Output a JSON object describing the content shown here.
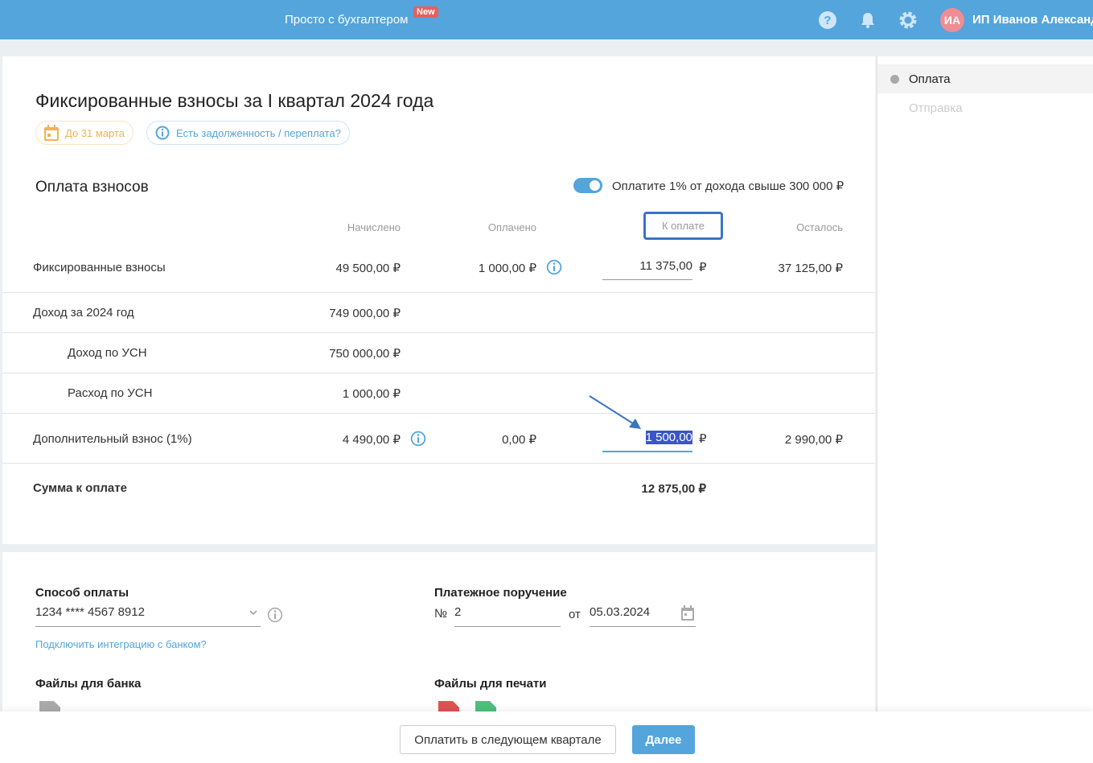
{
  "header": {
    "brand": "Просто с бухгалтером",
    "badge": "New",
    "avatar": "ИА",
    "user": "ИП Иванов Александ"
  },
  "sidebar": {
    "items": [
      {
        "label": "Оплата",
        "active": true
      },
      {
        "label": "Отправка",
        "active": false
      }
    ]
  },
  "page": {
    "title": "Фиксированные взносы за I квартал 2024 года",
    "deadline": "До 31 марта",
    "debt_link": "Есть задолженность / переплата?"
  },
  "payments": {
    "title": "Оплата взносов",
    "toggle_label": "Оплатите 1% от дохода свыше 300 000 ₽",
    "toggle_on": true,
    "columns": [
      "Начислено",
      "Оплачено",
      "К оплате",
      "Осталось"
    ],
    "currency": "₽",
    "rows": {
      "fixed": {
        "label": "Фиксированные взносы",
        "accrued": "49 500,00 ₽",
        "paid": "1 000,00 ₽",
        "to_pay": "11 375,00",
        "left": "37 125,00 ₽"
      },
      "income": {
        "label": "Доход за 2024 год",
        "accrued": "749 000,00 ₽"
      },
      "usn_income": {
        "label": "Доход по УСН",
        "accrued": "750 000,00 ₽"
      },
      "usn_expense": {
        "label": "Расход по УСН",
        "accrued": "1 000,00 ₽"
      },
      "extra": {
        "label": "Дополнительный взнос (1%)",
        "accrued": "4 490,00 ₽",
        "paid": "0,00 ₽",
        "to_pay": "1 500,00",
        "left": "2 990,00 ₽"
      }
    },
    "total": {
      "label": "Сумма к оплате",
      "value": "12 875,00 ₽"
    }
  },
  "payment_form": {
    "method_label": "Способ оплаты",
    "method_value": "1234 **** 4567 8912",
    "bank_link": "Подключить интеграцию с банком?",
    "order_label": "Платежное поручение",
    "number_prefix": "№",
    "number": "2",
    "date_prefix": "от",
    "date": "05.03.2024",
    "bank_files": "Файлы для банка",
    "print_files": "Файлы для печати"
  },
  "footer": {
    "later": "Оплатить в следующем квартале",
    "next": "Далее"
  },
  "colors": {
    "accent": "#53a5dc",
    "badge": "#e5605f"
  }
}
